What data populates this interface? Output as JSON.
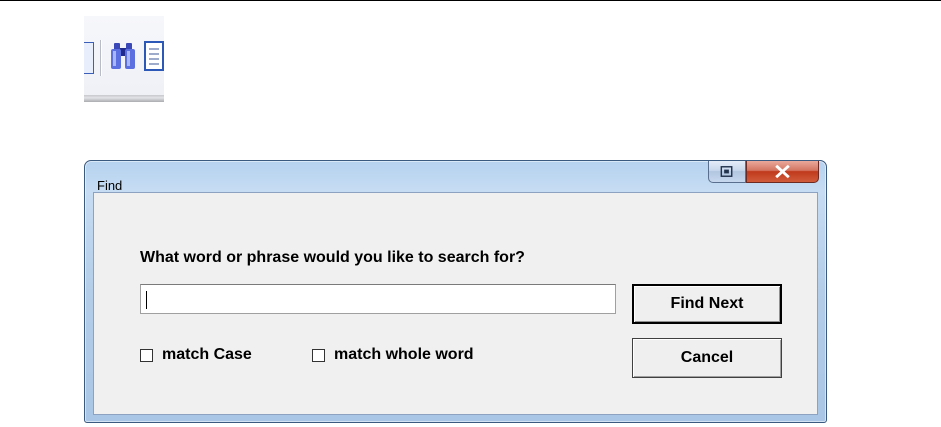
{
  "toolbar": {
    "icons": [
      "toolbar-button-edge",
      "binoculars-icon",
      "document-icon"
    ]
  },
  "dialog": {
    "title": "Find",
    "prompt": "What word or phrase would you like to search for?",
    "search": {
      "value": "",
      "placeholder": ""
    },
    "buttons": {
      "find_next": "Find Next",
      "cancel": "Cancel"
    },
    "options": {
      "match_case": {
        "label": "match Case",
        "checked": false
      },
      "match_whole_word": {
        "label": "match whole word",
        "checked": false
      }
    },
    "title_buttons": [
      "restore-icon",
      "close-icon"
    ]
  },
  "colors": {
    "frame": "#b5d2ef",
    "body": "#f0f0f0",
    "close_button": "#c0391c"
  }
}
